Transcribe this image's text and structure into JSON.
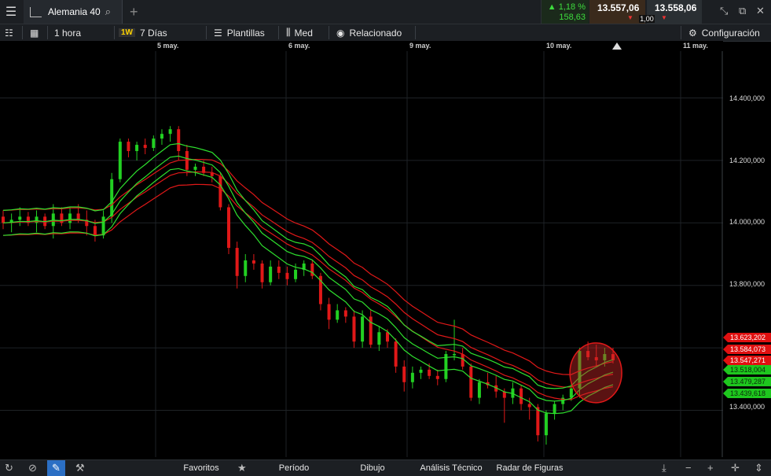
{
  "topbar": {
    "tab_title": "Alemania 40",
    "change_pct": "▲ 1,18 %",
    "change_pts": "158,63",
    "bid": "13.557,06",
    "ask": "13.558,06",
    "spread": "1,00"
  },
  "toolbar": {
    "interval": "1 hora",
    "range_badge": "1W",
    "range": "7 Días",
    "templates": "Plantillas",
    "style": "Med",
    "related": "Relacionado",
    "settings": "Configuración"
  },
  "dates": [
    "5 may.",
    "6 may.",
    "9 may.",
    "10 may.",
    "11 may."
  ],
  "price_ticks": [
    "14.400,000",
    "14.200,000",
    "14.000,000",
    "13.800,000",
    "13.400,000"
  ],
  "price_boxes": [
    {
      "label": "13.623,202",
      "kind": "red"
    },
    {
      "label": "13.584,073",
      "kind": "red"
    },
    {
      "label": "13.547,271",
      "kind": "red"
    },
    {
      "label": "13.518,004",
      "kind": "green"
    },
    {
      "label": "13.479,287",
      "kind": "green"
    },
    {
      "label": "13.439,618",
      "kind": "green"
    }
  ],
  "bottombar": {
    "favorites": "Favoritos",
    "period": "Período",
    "drawing": "Dibujo",
    "technical": "Análisis Técnico",
    "patterns": "Radar de Figuras"
  },
  "chart_data": {
    "type": "line",
    "instrument": "Alemania 40",
    "x_categories": [
      "5 may.",
      "6 may.",
      "9 may.",
      "10 may.",
      "11 may."
    ],
    "ylim": [
      13250,
      14550
    ],
    "y_ticks": [
      13400,
      13800,
      14000,
      14200,
      14400
    ],
    "grid": true,
    "candles_approx": [
      {
        "o": 14020,
        "h": 14040,
        "l": 13980,
        "c": 14000
      },
      {
        "o": 14000,
        "h": 14030,
        "l": 13970,
        "c": 14010
      },
      {
        "o": 14010,
        "h": 14050,
        "l": 13990,
        "c": 14020
      },
      {
        "o": 14020,
        "h": 14035,
        "l": 13990,
        "c": 14000
      },
      {
        "o": 14000,
        "h": 14040,
        "l": 13970,
        "c": 14020
      },
      {
        "o": 14020,
        "h": 14030,
        "l": 13980,
        "c": 13990
      },
      {
        "o": 13990,
        "h": 14060,
        "l": 13950,
        "c": 14030
      },
      {
        "o": 14030,
        "h": 14050,
        "l": 13990,
        "c": 14000
      },
      {
        "o": 14000,
        "h": 14050,
        "l": 13980,
        "c": 14030
      },
      {
        "o": 14030,
        "h": 14060,
        "l": 14000,
        "c": 14010
      },
      {
        "o": 14010,
        "h": 14040,
        "l": 13960,
        "c": 13990
      },
      {
        "o": 13990,
        "h": 14010,
        "l": 13940,
        "c": 13960
      },
      {
        "o": 13960,
        "h": 14040,
        "l": 13950,
        "c": 14020
      },
      {
        "o": 14020,
        "h": 14160,
        "l": 14000,
        "c": 14140
      },
      {
        "o": 14140,
        "h": 14270,
        "l": 14130,
        "c": 14260
      },
      {
        "o": 14260,
        "h": 14270,
        "l": 14210,
        "c": 14230
      },
      {
        "o": 14230,
        "h": 14260,
        "l": 14200,
        "c": 14250
      },
      {
        "o": 14250,
        "h": 14270,
        "l": 14220,
        "c": 14240
      },
      {
        "o": 14240,
        "h": 14280,
        "l": 14230,
        "c": 14270
      },
      {
        "o": 14270,
        "h": 14300,
        "l": 14250,
        "c": 14285
      },
      {
        "o": 14285,
        "h": 14310,
        "l": 14260,
        "c": 14300
      },
      {
        "o": 14300,
        "h": 14310,
        "l": 14200,
        "c": 14230
      },
      {
        "o": 14230,
        "h": 14250,
        "l": 14150,
        "c": 14170
      },
      {
        "o": 14170,
        "h": 14190,
        "l": 14150,
        "c": 14180
      },
      {
        "o": 14180,
        "h": 14200,
        "l": 14150,
        "c": 14160
      },
      {
        "o": 14160,
        "h": 14180,
        "l": 14130,
        "c": 14150
      },
      {
        "o": 14150,
        "h": 14160,
        "l": 14040,
        "c": 14050
      },
      {
        "o": 14050,
        "h": 14060,
        "l": 13900,
        "c": 13920
      },
      {
        "o": 13920,
        "h": 13940,
        "l": 13790,
        "c": 13830
      },
      {
        "o": 13830,
        "h": 13900,
        "l": 13810,
        "c": 13880
      },
      {
        "o": 13880,
        "h": 13900,
        "l": 13850,
        "c": 13870
      },
      {
        "o": 13870,
        "h": 13880,
        "l": 13790,
        "c": 13810
      },
      {
        "o": 13810,
        "h": 13880,
        "l": 13800,
        "c": 13860
      },
      {
        "o": 13860,
        "h": 13880,
        "l": 13820,
        "c": 13840
      },
      {
        "o": 13840,
        "h": 13860,
        "l": 13800,
        "c": 13820
      },
      {
        "o": 13820,
        "h": 13870,
        "l": 13810,
        "c": 13850
      },
      {
        "o": 13850,
        "h": 13880,
        "l": 13830,
        "c": 13870
      },
      {
        "o": 13870,
        "h": 13880,
        "l": 13820,
        "c": 13830
      },
      {
        "o": 13830,
        "h": 13840,
        "l": 13720,
        "c": 13740
      },
      {
        "o": 13740,
        "h": 13760,
        "l": 13660,
        "c": 13690
      },
      {
        "o": 13690,
        "h": 13740,
        "l": 13680,
        "c": 13720
      },
      {
        "o": 13720,
        "h": 13730,
        "l": 13680,
        "c": 13700
      },
      {
        "o": 13700,
        "h": 13720,
        "l": 13600,
        "c": 13620
      },
      {
        "o": 13620,
        "h": 13720,
        "l": 13600,
        "c": 13700
      },
      {
        "o": 13700,
        "h": 13720,
        "l": 13600,
        "c": 13610
      },
      {
        "o": 13610,
        "h": 13670,
        "l": 13590,
        "c": 13650
      },
      {
        "o": 13650,
        "h": 13660,
        "l": 13600,
        "c": 13620
      },
      {
        "o": 13620,
        "h": 13630,
        "l": 13520,
        "c": 13540
      },
      {
        "o": 13540,
        "h": 13560,
        "l": 13460,
        "c": 13490
      },
      {
        "o": 13490,
        "h": 13540,
        "l": 13470,
        "c": 13520
      },
      {
        "o": 13520,
        "h": 13540,
        "l": 13500,
        "c": 13530
      },
      {
        "o": 13530,
        "h": 13550,
        "l": 13500,
        "c": 13510
      },
      {
        "o": 13510,
        "h": 13530,
        "l": 13480,
        "c": 13500
      },
      {
        "o": 13500,
        "h": 13590,
        "l": 13490,
        "c": 13580
      },
      {
        "o": 13580,
        "h": 13690,
        "l": 13560,
        "c": 13580
      },
      {
        "o": 13580,
        "h": 13600,
        "l": 13530,
        "c": 13540
      },
      {
        "o": 13540,
        "h": 13550,
        "l": 13430,
        "c": 13440
      },
      {
        "o": 13440,
        "h": 13500,
        "l": 13420,
        "c": 13490
      },
      {
        "o": 13490,
        "h": 13520,
        "l": 13470,
        "c": 13480
      },
      {
        "o": 13480,
        "h": 13510,
        "l": 13440,
        "c": 13460
      },
      {
        "o": 13460,
        "h": 13470,
        "l": 13360,
        "c": 13440
      },
      {
        "o": 13440,
        "h": 13490,
        "l": 13420,
        "c": 13470
      },
      {
        "o": 13470,
        "h": 13480,
        "l": 13400,
        "c": 13420
      },
      {
        "o": 13420,
        "h": 13440,
        "l": 13370,
        "c": 13410
      },
      {
        "o": 13410,
        "h": 13420,
        "l": 13300,
        "c": 13320
      },
      {
        "o": 13320,
        "h": 13400,
        "l": 13290,
        "c": 13390
      },
      {
        "o": 13390,
        "h": 13430,
        "l": 13370,
        "c": 13420
      },
      {
        "o": 13420,
        "h": 13450,
        "l": 13400,
        "c": 13440
      },
      {
        "o": 13440,
        "h": 13490,
        "l": 13430,
        "c": 13470
      },
      {
        "o": 13470,
        "h": 13600,
        "l": 13440,
        "c": 13590
      },
      {
        "o": 13590,
        "h": 13620,
        "l": 13560,
        "c": 13570
      },
      {
        "o": 13570,
        "h": 13610,
        "l": 13540,
        "c": 13560
      },
      {
        "o": 13560,
        "h": 13600,
        "l": 13540,
        "c": 13580
      },
      {
        "o": 13580,
        "h": 13600,
        "l": 13550,
        "c": 13560
      }
    ],
    "bands_note_values": {
      "red_upper": 13623.202,
      "red_mid": 13584.073,
      "red_lower": 13547.271,
      "green_upper": 13518.004,
      "green_mid": 13479.287,
      "green_lower": 13439.618
    },
    "highlight": {
      "x_index": 70,
      "y": 13520
    }
  }
}
